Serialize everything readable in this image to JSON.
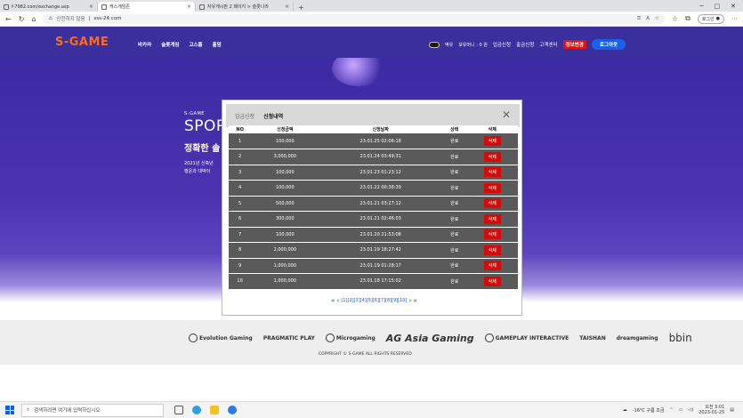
{
  "browser": {
    "tabs": [
      {
        "label": "f-7982.com/exchange.asp",
        "active": false
      },
      {
        "label": "캐스게임존",
        "active": true
      },
      {
        "label": "자유게시판 2 페이지 > 슬롯나라",
        "active": false
      }
    ],
    "new_tab": "+",
    "window_controls": [
      "─",
      "□",
      "✕"
    ],
    "address": {
      "security": "안전하지 않음",
      "url": "sss-24.com"
    },
    "login_label": "로그인",
    "more": "⋯"
  },
  "site": {
    "logo": "S-GAME",
    "main_nav": [
      "바카라",
      "슬롯게임",
      "고스톱",
      "홀덤"
    ],
    "rewards_label": "벽유",
    "points_label": "보유머니 : 0 원",
    "deposit_label": "입금신청",
    "withdraw_label": "출금신청",
    "support_label": "고객센터",
    "inquiry_label": "정보변경",
    "logout_label": "로그아웃"
  },
  "hero": {
    "brand": "S-GAME",
    "title": "SPOR",
    "subtitle": "정확한 솔",
    "line1": "2021년 신축년",
    "line2": "행운과 대박이"
  },
  "modal": {
    "tab_deposit": "입금신청",
    "tab_history": "신청내역",
    "close": "✕",
    "columns": [
      "NO",
      "신청금액",
      "신청날짜",
      "상태",
      "삭제"
    ],
    "rows": [
      {
        "no": "1",
        "amount": "100,000",
        "date": "23.01.25 02:06:18",
        "status": "완료",
        "del": "삭제"
      },
      {
        "no": "2",
        "amount": "3,000,000",
        "date": "23.01.24 03:49:31",
        "status": "완료",
        "del": "삭제"
      },
      {
        "no": "3",
        "amount": "100,000",
        "date": "23.01.23 01:23:12",
        "status": "완료",
        "del": "삭제"
      },
      {
        "no": "4",
        "amount": "100,000",
        "date": "23.01.22 00:38:39",
        "status": "완료",
        "del": "삭제"
      },
      {
        "no": "5",
        "amount": "500,000",
        "date": "23.01.21 03:27:12",
        "status": "완료",
        "del": "삭제"
      },
      {
        "no": "6",
        "amount": "300,000",
        "date": "23.01.21 02:46:03",
        "status": "완료",
        "del": "삭제"
      },
      {
        "no": "7",
        "amount": "100,000",
        "date": "23.01.20 21:53:08",
        "status": "완료",
        "del": "삭제"
      },
      {
        "no": "8",
        "amount": "2,000,000",
        "date": "23.01.19 18:27:42",
        "status": "완료",
        "del": "삭제"
      },
      {
        "no": "9",
        "amount": "1,000,000",
        "date": "23.01.19 01:28:17",
        "status": "완료",
        "del": "삭제"
      },
      {
        "no": "10",
        "amount": "1,000,000",
        "date": "23.01.18 17:15:02",
        "status": "완료",
        "del": "삭제"
      }
    ],
    "pager": {
      "first": "«",
      "prev": "‹",
      "pages": "[1][2][3][4][5][6][7][8][9][10]",
      "next": "›",
      "last": "»"
    }
  },
  "footer": {
    "providers": [
      "Evolution Gaming",
      "PRAGMATIC PLAY",
      "Microgaming",
      "AG Asia Gaming",
      "GAMEPLAY INTERACTIVE",
      "TAISHAN",
      "dreamgaming",
      "bbin"
    ],
    "copyright": "COPYRIGHT © S-GAME ALL RIGHTS RESERVED"
  },
  "taskbar": {
    "search_placeholder": "검색하려면 여기에 입력하십시오.",
    "weather": "-16°C 구름 조금",
    "time": "오전 3:01",
    "date": "2023-01-25"
  },
  "colors": {
    "site_header": "#3b2e9d",
    "logo": "#ff6a1a",
    "logout": "#1760e8",
    "delete": "#d30b0b",
    "row_bg": "#5a5a5a"
  }
}
